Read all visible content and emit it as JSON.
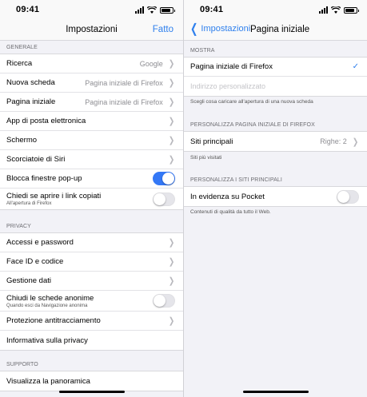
{
  "left": {
    "status_time": "09:41",
    "title": "Impostazioni",
    "done": "Fatto",
    "sections": [
      {
        "header": "GENERALE",
        "rows": [
          {
            "label": "Ricerca",
            "value": "Google",
            "kind": "chevron"
          },
          {
            "label": "Nuova scheda",
            "value": "Pagina iniziale di Firefox",
            "kind": "chevron"
          },
          {
            "label": "Pagina iniziale",
            "value": "Pagina iniziale di Firefox",
            "kind": "chevron"
          },
          {
            "label": "App di posta elettronica",
            "kind": "chevron"
          },
          {
            "label": "Schermo",
            "kind": "chevron"
          },
          {
            "label": "Scorciatoie di Siri",
            "kind": "chevron"
          },
          {
            "label": "Blocca finestre pop-up",
            "kind": "toggle",
            "on": true
          },
          {
            "label": "Chiedi se aprire i link copiati",
            "sub": "All'apertura di Firefox",
            "kind": "toggle",
            "on": false
          }
        ]
      },
      {
        "header": "PRIVACY",
        "rows": [
          {
            "label": "Accessi e password",
            "kind": "chevron"
          },
          {
            "label": "Face ID e codice",
            "kind": "chevron"
          },
          {
            "label": "Gestione dati",
            "kind": "chevron"
          },
          {
            "label": "Chiudi le schede anonime",
            "sub": "Quando esci da Navigazione anonima",
            "kind": "toggle",
            "on": false
          },
          {
            "label": "Protezione antitracciamento",
            "kind": "chevron"
          },
          {
            "label": "Informativa sulla privacy",
            "kind": "none"
          }
        ]
      },
      {
        "header": "SUPPORTO",
        "rows": [
          {
            "label": "Visualizza la panoramica",
            "kind": "none"
          }
        ]
      }
    ]
  },
  "right": {
    "status_time": "09:41",
    "back": "Impostazioni",
    "title": "Pagina iniziale",
    "show_header": "MOSTRA",
    "opt_firefox": "Pagina iniziale di Firefox",
    "opt_custom_placeholder": "Indirizzo personalizzato",
    "show_note": "Scegli cosa caricare all'apertura di una nuova scheda",
    "personalize_header": "PERSONALIZZA PAGINA INIZIALE DI FIREFOX",
    "top_sites_label": "Siti principali",
    "top_sites_value": "Righe: 2",
    "top_sites_note": "Siti più visitati",
    "top_sites_header": "PERSONALIZZA I SITI PRINCIPALI",
    "pocket_label": "In evidenza su Pocket",
    "pocket_on": false,
    "pocket_note": "Contenuti di qualità da tutto il Web."
  },
  "colors": {
    "accent": "#2f80ed",
    "toggle_on": "#3478f6"
  }
}
